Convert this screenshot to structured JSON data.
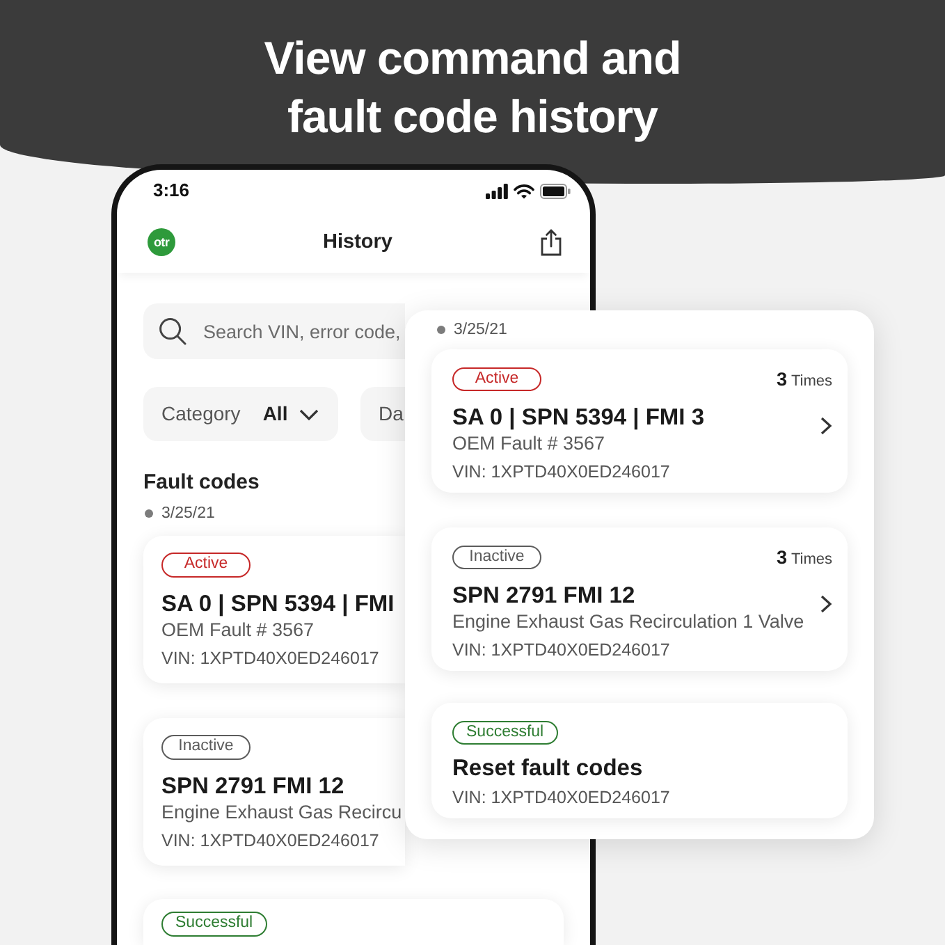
{
  "headline": "View command and fault code history",
  "phone": {
    "status_bar": {
      "time": "3:16"
    },
    "header": {
      "logo": "otr",
      "title": "History"
    },
    "search": {
      "placeholder": "Search VIN, error code,"
    },
    "filters": [
      {
        "label": "Category",
        "value": "All"
      },
      {
        "label": "Da"
      }
    ],
    "section_title": "Fault codes",
    "date": "3/25/21",
    "entries": [
      {
        "kind": "active",
        "badge": "Active",
        "title": "SA 0 | SPN 5394 | FMI",
        "subtitle": "OEM Fault # 3567",
        "vin": "VIN: 1XPTD40X0ED246017"
      },
      {
        "kind": "inactive",
        "badge": "Inactive",
        "title": "SPN 2791 FMI 12",
        "subtitle": "Engine Exhaust Gas Recircu",
        "vin": "VIN: 1XPTD40X0ED246017"
      },
      {
        "kind": "successful",
        "badge": "Successful"
      }
    ]
  },
  "detail_panel": {
    "date": "3/25/21",
    "entries": [
      {
        "kind": "active",
        "badge": "Active",
        "count": "3",
        "count_unit": "Times",
        "title": "SA 0 | SPN 5394 | FMI 3",
        "subtitle": "OEM Fault # 3567",
        "vin": "VIN: 1XPTD40X0ED246017",
        "chevron": true
      },
      {
        "kind": "inactive",
        "badge": "Inactive",
        "count": "3",
        "count_unit": "Times",
        "title": "SPN 2791 FMI 12",
        "subtitle": "Engine Exhaust Gas Recirculation 1 Valve",
        "vin": "VIN: 1XPTD40X0ED246017",
        "chevron": true
      },
      {
        "kind": "successful",
        "badge": "Successful",
        "title": "Reset fault codes",
        "vin": "VIN: 1XPTD40X0ED246017",
        "chevron": false
      }
    ]
  }
}
